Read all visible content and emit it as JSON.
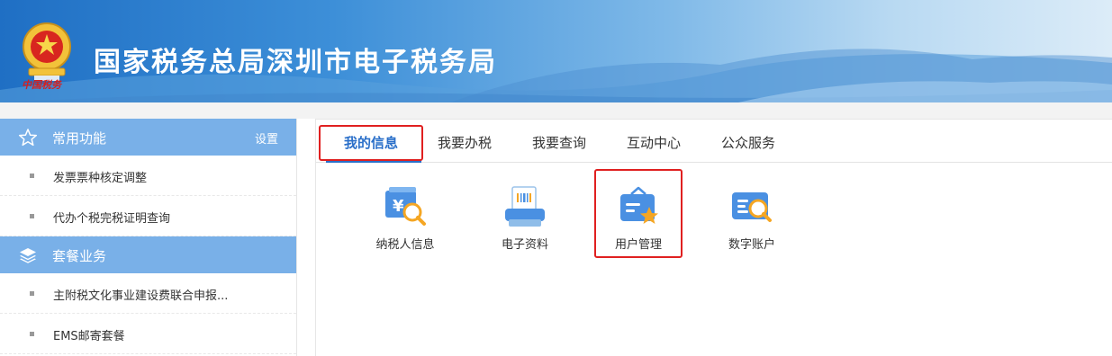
{
  "header": {
    "title": "国家税务总局深圳市电子税务局",
    "logo_caption": "中国税务",
    "logo_icon": "tax-emblem-icon",
    "colors": {
      "banner_dark": "#1f6fc4",
      "banner_light": "#dcecf8"
    }
  },
  "sidebar": {
    "sections": [
      {
        "title": "常用功能",
        "icon": "star-icon",
        "action": "设置",
        "items": [
          {
            "label": "发票票种核定调整"
          },
          {
            "label": "代办个税完税证明查询"
          }
        ]
      },
      {
        "title": "套餐业务",
        "icon": "layers-icon",
        "items": [
          {
            "label": "主附税文化事业建设费联合申报..."
          },
          {
            "label": "EMS邮寄套餐"
          }
        ]
      }
    ],
    "colors": {
      "section_header": "#79b0e8"
    }
  },
  "tabs": [
    {
      "label": "我的信息",
      "active": true
    },
    {
      "label": "我要办税"
    },
    {
      "label": "我要查询"
    },
    {
      "label": "互动中心"
    },
    {
      "label": "公众服务"
    }
  ],
  "apps": [
    {
      "label": "纳税人信息",
      "icon": "taxpayer-info-icon"
    },
    {
      "label": "电子资料",
      "icon": "electronic-data-icon"
    },
    {
      "label": "用户管理",
      "icon": "user-management-icon",
      "highlighted": true
    },
    {
      "label": "数字账户",
      "icon": "digital-account-icon"
    }
  ],
  "colors": {
    "accent": "#2a6fc9",
    "highlight": "#e02020"
  }
}
